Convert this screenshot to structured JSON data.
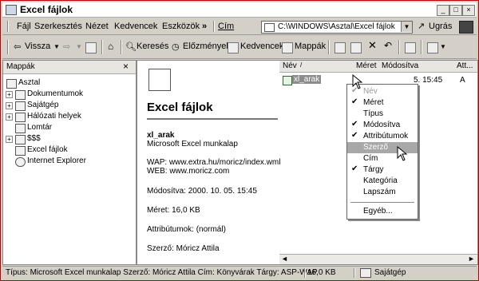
{
  "window": {
    "title": "Excel fájlok",
    "minimize_glyph": "_",
    "maximize_glyph": "□",
    "close_glyph": "×"
  },
  "menubar": {
    "items": [
      "Fájl",
      "Szerkesztés",
      "Nézet",
      "Kedvencek",
      "Eszközök"
    ],
    "more_glyph": "»",
    "address_label": "Cím",
    "address_value": "C:\\WINDOWS\\Asztal\\Excel fájlok",
    "go_label": "Ugrás"
  },
  "toolbar": {
    "back": "Vissza",
    "search": "Keresés",
    "history": "Előzmények",
    "favorites": "Kedvencek",
    "folders": "Mappák"
  },
  "leftpane": {
    "title": "Mappák",
    "close_glyph": "×",
    "tree": [
      {
        "label": "Asztal"
      },
      {
        "label": "Dokumentumok"
      },
      {
        "label": "Sajátgép"
      },
      {
        "label": "Hálózati helyek"
      },
      {
        "label": "Lomtár"
      },
      {
        "label": "$$$"
      },
      {
        "label": "Excel fájlok"
      },
      {
        "label": "Internet Explorer"
      }
    ]
  },
  "doc": {
    "title": "Excel fájlok",
    "file_name": "xl_arak",
    "file_type": "Microsoft Excel munkalap",
    "wap": "WAP: www.extra.hu/moricz/index.wml",
    "web": "WEB: www.moricz.com",
    "modified": "Módosítva: 2000. 10. 05. 15:45",
    "size": "Méret: 16,0 KB",
    "attributes": "Attribútumok: (normál)",
    "author": "Szerző: Móricz Attila"
  },
  "columns": {
    "name": "Név",
    "size": "Méret",
    "modified": "Módosítva",
    "attr": "Att..."
  },
  "file_row": {
    "name": "xl_arak",
    "modified_tail": "5. 15:45",
    "attr": "A"
  },
  "context_menu": {
    "items": [
      {
        "label": "Név",
        "checked": true,
        "disabled": true
      },
      {
        "label": "Méret",
        "checked": true,
        "disabled": false
      },
      {
        "label": "Típus",
        "checked": false,
        "disabled": false
      },
      {
        "label": "Módosítva",
        "checked": true,
        "disabled": false
      },
      {
        "label": "Attribútumok",
        "checked": true,
        "disabled": false
      },
      {
        "label": "Szerző",
        "checked": false,
        "disabled": false,
        "highlighted": true
      },
      {
        "label": "Cím",
        "checked": false,
        "disabled": false
      },
      {
        "label": "Tárgy",
        "checked": true,
        "disabled": false
      },
      {
        "label": "Kategória",
        "checked": false,
        "disabled": false
      },
      {
        "label": "Lapszám",
        "checked": false,
        "disabled": false
      }
    ],
    "more": "Egyéb..."
  },
  "status": {
    "text": "Típus: Microsoft Excel munkalap Szerző: Móricz Attila Cím: Könyvárak Tárgy: ASP-WAP",
    "size": "16,0 KB",
    "location": "Sajátgép"
  },
  "colors": {
    "window_border": "#c00000",
    "chrome": "#d4d0c8",
    "menu_highlight": "#a8a8a8"
  }
}
